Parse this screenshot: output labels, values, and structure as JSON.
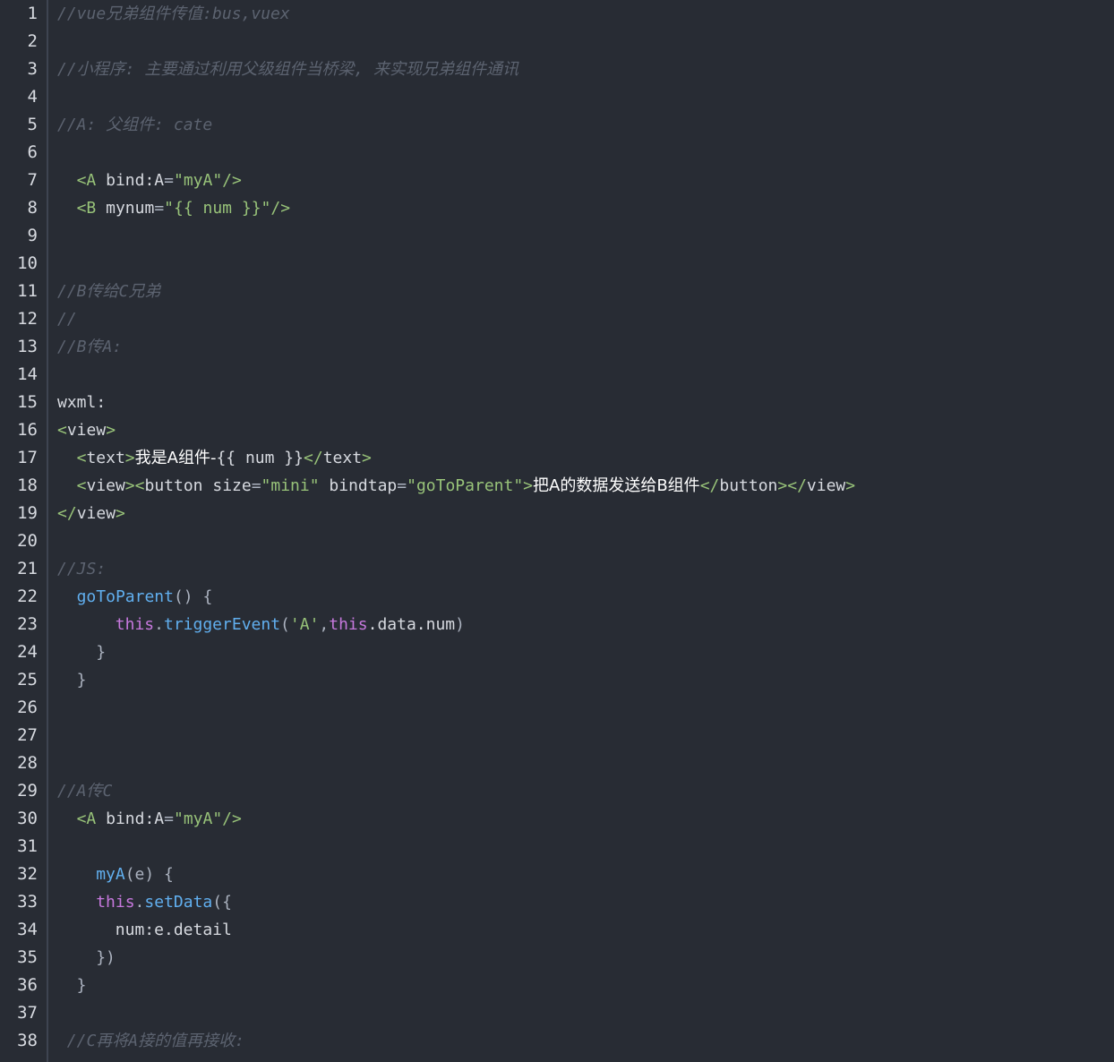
{
  "colors": {
    "background": "#282c34",
    "gutter_border": "#3e4451",
    "line_number": "#d7dae0",
    "comment": "#5c6370",
    "tag": "#98c379",
    "string": "#98c379",
    "function": "#61afef",
    "keyword": "#c678dd",
    "text": "#d7dae0"
  },
  "lines": [
    {
      "n": "1",
      "indent": 0,
      "tokens": [
        {
          "c": "comment",
          "t": "//vue兄弟组件传值:bus,vuex"
        }
      ]
    },
    {
      "n": "2",
      "indent": 0,
      "tokens": []
    },
    {
      "n": "3",
      "indent": 0,
      "tokens": [
        {
          "c": "comment",
          "t": "//小程序: 主要通过利用父级组件当桥梁, 来实现兄弟组件通讯"
        }
      ]
    },
    {
      "n": "4",
      "indent": 0,
      "tokens": []
    },
    {
      "n": "5",
      "indent": 0,
      "tokens": [
        {
          "c": "comment",
          "t": "//A: 父组件: cate"
        }
      ]
    },
    {
      "n": "6",
      "indent": 0,
      "tokens": []
    },
    {
      "n": "7",
      "indent": 2,
      "tokens": [
        {
          "c": "tag",
          "t": "<A"
        },
        {
          "c": "attr",
          "t": " bind:A"
        },
        {
          "c": "pun",
          "t": "="
        },
        {
          "c": "str",
          "t": "\"myA\""
        },
        {
          "c": "tag",
          "t": "/>"
        }
      ]
    },
    {
      "n": "8",
      "indent": 2,
      "tokens": [
        {
          "c": "tag",
          "t": "<B"
        },
        {
          "c": "attr",
          "t": " mynum"
        },
        {
          "c": "pun",
          "t": "="
        },
        {
          "c": "str",
          "t": "\"{{ num }}\""
        },
        {
          "c": "tag",
          "t": "/>"
        }
      ]
    },
    {
      "n": "9",
      "indent": 0,
      "tokens": []
    },
    {
      "n": "10",
      "indent": 0,
      "tokens": []
    },
    {
      "n": "11",
      "indent": 0,
      "tokens": [
        {
          "c": "comment",
          "t": "//B传给C兄弟"
        }
      ]
    },
    {
      "n": "12",
      "indent": 0,
      "tokens": [
        {
          "c": "comment",
          "t": "//"
        }
      ]
    },
    {
      "n": "13",
      "indent": 0,
      "tokens": [
        {
          "c": "comment",
          "t": "//B传A:"
        }
      ]
    },
    {
      "n": "14",
      "indent": 0,
      "tokens": []
    },
    {
      "n": "15",
      "indent": 0,
      "tokens": [
        {
          "c": "plain",
          "t": "wxml:"
        }
      ]
    },
    {
      "n": "16",
      "indent": 0,
      "tokens": [
        {
          "c": "tag",
          "t": "<"
        },
        {
          "c": "plain",
          "t": "view"
        },
        {
          "c": "tag",
          "t": ">"
        }
      ]
    },
    {
      "n": "17",
      "indent": 2,
      "tokens": [
        {
          "c": "tag",
          "t": "<"
        },
        {
          "c": "plain",
          "t": "text"
        },
        {
          "c": "tag",
          "t": ">"
        },
        {
          "c": "cjk",
          "t": "我是A组件-"
        },
        {
          "c": "plain",
          "t": "{{ num }}"
        },
        {
          "c": "tag",
          "t": "</"
        },
        {
          "c": "plain",
          "t": "text"
        },
        {
          "c": "tag",
          "t": ">"
        }
      ]
    },
    {
      "n": "18",
      "indent": 2,
      "tokens": [
        {
          "c": "tag",
          "t": "<"
        },
        {
          "c": "plain",
          "t": "view"
        },
        {
          "c": "tag",
          "t": "><"
        },
        {
          "c": "plain",
          "t": "button"
        },
        {
          "c": "attr",
          "t": " size"
        },
        {
          "c": "pun",
          "t": "="
        },
        {
          "c": "str",
          "t": "\"mini\""
        },
        {
          "c": "attr",
          "t": " bindtap"
        },
        {
          "c": "pun",
          "t": "="
        },
        {
          "c": "str",
          "t": "\"goToParent\""
        },
        {
          "c": "tag",
          "t": ">"
        },
        {
          "c": "cjk",
          "t": "把A的数据发送给B组件"
        },
        {
          "c": "tag",
          "t": "</"
        },
        {
          "c": "plain",
          "t": "button"
        },
        {
          "c": "tag",
          "t": "></"
        },
        {
          "c": "plain",
          "t": "view"
        },
        {
          "c": "tag",
          "t": ">"
        }
      ]
    },
    {
      "n": "19",
      "indent": 0,
      "tokens": [
        {
          "c": "tag",
          "t": "</"
        },
        {
          "c": "plain",
          "t": "view"
        },
        {
          "c": "tag",
          "t": ">"
        }
      ]
    },
    {
      "n": "20",
      "indent": 0,
      "tokens": []
    },
    {
      "n": "21",
      "indent": 0,
      "tokens": [
        {
          "c": "comment",
          "t": "//JS:"
        }
      ]
    },
    {
      "n": "22",
      "indent": 2,
      "tokens": [
        {
          "c": "fn",
          "t": "goToParent"
        },
        {
          "c": "pun",
          "t": "() {"
        }
      ]
    },
    {
      "n": "23",
      "indent": 6,
      "tokens": [
        {
          "c": "kw",
          "t": "this"
        },
        {
          "c": "pun",
          "t": "."
        },
        {
          "c": "fn",
          "t": "triggerEvent"
        },
        {
          "c": "pun",
          "t": "("
        },
        {
          "c": "str",
          "t": "'A'"
        },
        {
          "c": "pun",
          "t": ","
        },
        {
          "c": "kw",
          "t": "this"
        },
        {
          "c": "plain",
          "t": ".data.num"
        },
        {
          "c": "pun",
          "t": ")"
        }
      ]
    },
    {
      "n": "24",
      "indent": 4,
      "tokens": [
        {
          "c": "pun",
          "t": "}"
        }
      ]
    },
    {
      "n": "25",
      "indent": 2,
      "tokens": [
        {
          "c": "pun",
          "t": "}"
        }
      ]
    },
    {
      "n": "26",
      "indent": 0,
      "tokens": []
    },
    {
      "n": "27",
      "indent": 0,
      "tokens": []
    },
    {
      "n": "28",
      "indent": 0,
      "tokens": []
    },
    {
      "n": "29",
      "indent": 0,
      "tokens": [
        {
          "c": "comment",
          "t": "//A传C"
        }
      ]
    },
    {
      "n": "30",
      "indent": 2,
      "tokens": [
        {
          "c": "tag",
          "t": "<A"
        },
        {
          "c": "attr",
          "t": " bind:A"
        },
        {
          "c": "pun",
          "t": "="
        },
        {
          "c": "str",
          "t": "\"myA\""
        },
        {
          "c": "tag",
          "t": "/>"
        }
      ]
    },
    {
      "n": "31",
      "indent": 0,
      "tokens": []
    },
    {
      "n": "32",
      "indent": 4,
      "tokens": [
        {
          "c": "fn",
          "t": "myA"
        },
        {
          "c": "pun",
          "t": "(e) {"
        }
      ]
    },
    {
      "n": "33",
      "indent": 4,
      "tokens": [
        {
          "c": "kw",
          "t": "this"
        },
        {
          "c": "pun",
          "t": "."
        },
        {
          "c": "fn",
          "t": "setData"
        },
        {
          "c": "pun",
          "t": "({"
        }
      ]
    },
    {
      "n": "34",
      "indent": 6,
      "tokens": [
        {
          "c": "plain",
          "t": "num:e.detail"
        }
      ]
    },
    {
      "n": "35",
      "indent": 4,
      "tokens": [
        {
          "c": "pun",
          "t": "})"
        }
      ]
    },
    {
      "n": "36",
      "indent": 2,
      "tokens": [
        {
          "c": "pun",
          "t": "}"
        }
      ]
    },
    {
      "n": "37",
      "indent": 0,
      "tokens": []
    },
    {
      "n": "38",
      "indent": 1,
      "tokens": [
        {
          "c": "comment",
          "t": "//C再将A接的值再接收:"
        }
      ]
    }
  ]
}
